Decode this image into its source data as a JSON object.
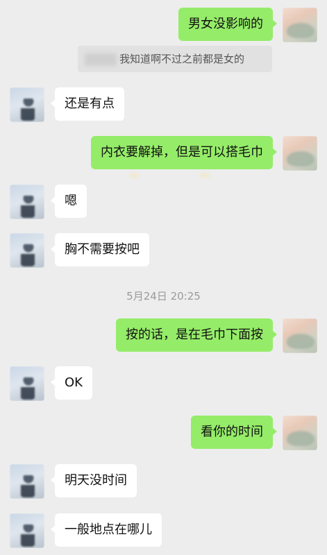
{
  "quote": {
    "text": "我知道啊不过之前都是女的"
  },
  "timestamp": "5月24日 20:25",
  "messages": [
    {
      "side": "right",
      "text": "男女没影响的"
    },
    {
      "side": "left",
      "text": "还是有点"
    },
    {
      "side": "right",
      "text": "内衣要解掉，但是可以搭毛巾"
    },
    {
      "side": "left",
      "text": "嗯"
    },
    {
      "side": "left",
      "text": "胸不需要按吧"
    },
    {
      "side": "right",
      "text": "按的话，是在毛巾下面按"
    },
    {
      "side": "left",
      "text": "OK"
    },
    {
      "side": "right",
      "text": "看你的时间"
    },
    {
      "side": "left",
      "text": "明天没时间"
    },
    {
      "side": "left",
      "text": "一般地点在哪儿"
    }
  ],
  "colors": {
    "background": "#ededed",
    "outgoing_bubble": "#95ec69",
    "incoming_bubble": "#ffffff"
  }
}
